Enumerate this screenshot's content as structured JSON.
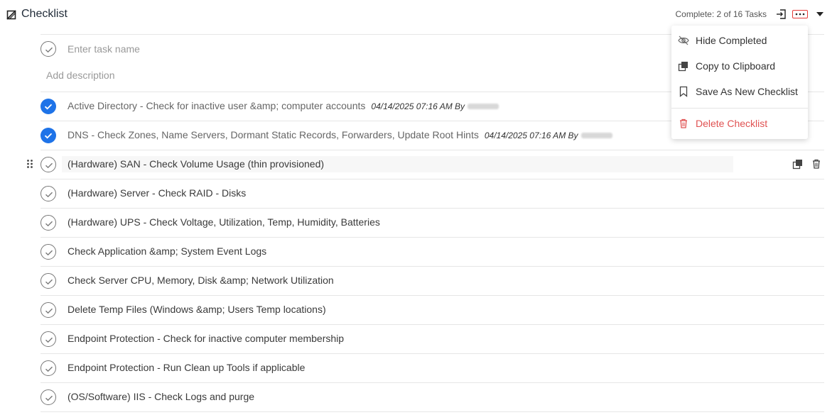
{
  "header": {
    "title": "Checklist",
    "complete_text": "Complete: 2 of 16 Tasks"
  },
  "new_task": {
    "placeholder": "Enter task name",
    "description_placeholder": "Add description"
  },
  "tasks": [
    {
      "label": "Active Directory - Check for inactive user &amp; computer accounts",
      "completed": true,
      "meta": "04/14/2025 07:16 AM By"
    },
    {
      "label": "DNS - Check Zones, Name Servers, Dormant Static Records, Forwarders, Update Root Hints",
      "completed": true,
      "meta": "04/14/2025 07:16 AM By"
    },
    {
      "label": "(Hardware) SAN - Check Volume Usage (thin provisioned)",
      "completed": false
    },
    {
      "label": "(Hardware) Server - Check RAID - Disks",
      "completed": false
    },
    {
      "label": "(Hardware) UPS - Check Voltage, Utilization, Temp, Humidity, Batteries",
      "completed": false
    },
    {
      "label": "Check Application &amp; System Event Logs",
      "completed": false
    },
    {
      "label": "Check Server CPU, Memory, Disk &amp; Network Utilization",
      "completed": false
    },
    {
      "label": "Delete Temp Files (Windows &amp; Users Temp locations)",
      "completed": false
    },
    {
      "label": "Endpoint Protection - Check for inactive computer membership",
      "completed": false
    },
    {
      "label": "Endpoint Protection - Run Clean up Tools if applicable",
      "completed": false
    },
    {
      "label": "(OS/Software) IIS - Check Logs and purge",
      "completed": false
    }
  ],
  "menu": {
    "items": [
      {
        "label": "Hide Completed",
        "icon": "eye-slash-icon"
      },
      {
        "label": "Copy to Clipboard",
        "icon": "copy-icon"
      },
      {
        "label": "Save As New Checklist",
        "icon": "bookmark-icon"
      },
      {
        "label": "Delete Checklist",
        "icon": "trash-icon"
      }
    ]
  },
  "colors": {
    "accent": "#1e73e8",
    "danger": "#e05252",
    "highlight_border": "#e53935"
  }
}
